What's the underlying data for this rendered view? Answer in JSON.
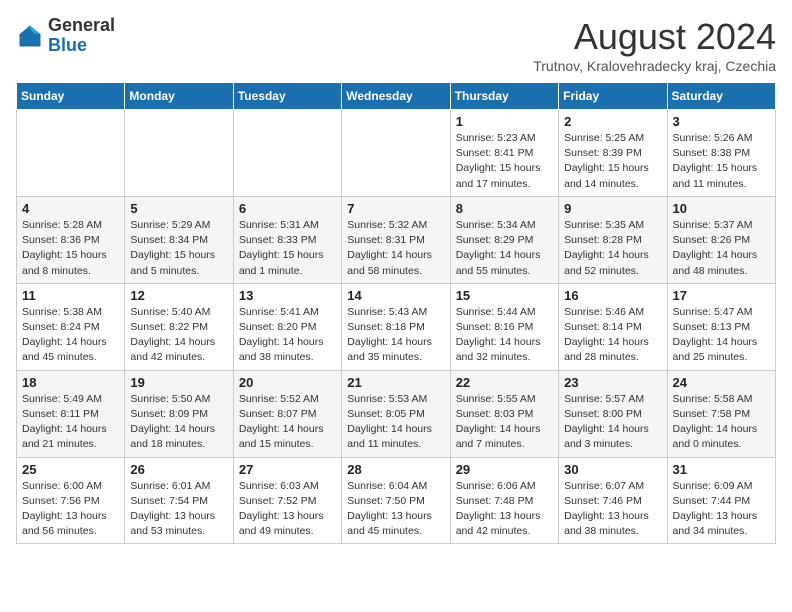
{
  "header": {
    "logo_line1": "General",
    "logo_line2": "Blue",
    "month_year": "August 2024",
    "location": "Trutnov, Kralovehradecky kraj, Czechia"
  },
  "days_of_week": [
    "Sunday",
    "Monday",
    "Tuesday",
    "Wednesday",
    "Thursday",
    "Friday",
    "Saturday"
  ],
  "weeks": [
    [
      {
        "day": "",
        "info": ""
      },
      {
        "day": "",
        "info": ""
      },
      {
        "day": "",
        "info": ""
      },
      {
        "day": "",
        "info": ""
      },
      {
        "day": "1",
        "info": "Sunrise: 5:23 AM\nSunset: 8:41 PM\nDaylight: 15 hours\nand 17 minutes."
      },
      {
        "day": "2",
        "info": "Sunrise: 5:25 AM\nSunset: 8:39 PM\nDaylight: 15 hours\nand 14 minutes."
      },
      {
        "day": "3",
        "info": "Sunrise: 5:26 AM\nSunset: 8:38 PM\nDaylight: 15 hours\nand 11 minutes."
      }
    ],
    [
      {
        "day": "4",
        "info": "Sunrise: 5:28 AM\nSunset: 8:36 PM\nDaylight: 15 hours\nand 8 minutes."
      },
      {
        "day": "5",
        "info": "Sunrise: 5:29 AM\nSunset: 8:34 PM\nDaylight: 15 hours\nand 5 minutes."
      },
      {
        "day": "6",
        "info": "Sunrise: 5:31 AM\nSunset: 8:33 PM\nDaylight: 15 hours\nand 1 minute."
      },
      {
        "day": "7",
        "info": "Sunrise: 5:32 AM\nSunset: 8:31 PM\nDaylight: 14 hours\nand 58 minutes."
      },
      {
        "day": "8",
        "info": "Sunrise: 5:34 AM\nSunset: 8:29 PM\nDaylight: 14 hours\nand 55 minutes."
      },
      {
        "day": "9",
        "info": "Sunrise: 5:35 AM\nSunset: 8:28 PM\nDaylight: 14 hours\nand 52 minutes."
      },
      {
        "day": "10",
        "info": "Sunrise: 5:37 AM\nSunset: 8:26 PM\nDaylight: 14 hours\nand 48 minutes."
      }
    ],
    [
      {
        "day": "11",
        "info": "Sunrise: 5:38 AM\nSunset: 8:24 PM\nDaylight: 14 hours\nand 45 minutes."
      },
      {
        "day": "12",
        "info": "Sunrise: 5:40 AM\nSunset: 8:22 PM\nDaylight: 14 hours\nand 42 minutes."
      },
      {
        "day": "13",
        "info": "Sunrise: 5:41 AM\nSunset: 8:20 PM\nDaylight: 14 hours\nand 38 minutes."
      },
      {
        "day": "14",
        "info": "Sunrise: 5:43 AM\nSunset: 8:18 PM\nDaylight: 14 hours\nand 35 minutes."
      },
      {
        "day": "15",
        "info": "Sunrise: 5:44 AM\nSunset: 8:16 PM\nDaylight: 14 hours\nand 32 minutes."
      },
      {
        "day": "16",
        "info": "Sunrise: 5:46 AM\nSunset: 8:14 PM\nDaylight: 14 hours\nand 28 minutes."
      },
      {
        "day": "17",
        "info": "Sunrise: 5:47 AM\nSunset: 8:13 PM\nDaylight: 14 hours\nand 25 minutes."
      }
    ],
    [
      {
        "day": "18",
        "info": "Sunrise: 5:49 AM\nSunset: 8:11 PM\nDaylight: 14 hours\nand 21 minutes."
      },
      {
        "day": "19",
        "info": "Sunrise: 5:50 AM\nSunset: 8:09 PM\nDaylight: 14 hours\nand 18 minutes."
      },
      {
        "day": "20",
        "info": "Sunrise: 5:52 AM\nSunset: 8:07 PM\nDaylight: 14 hours\nand 15 minutes."
      },
      {
        "day": "21",
        "info": "Sunrise: 5:53 AM\nSunset: 8:05 PM\nDaylight: 14 hours\nand 11 minutes."
      },
      {
        "day": "22",
        "info": "Sunrise: 5:55 AM\nSunset: 8:03 PM\nDaylight: 14 hours\nand 7 minutes."
      },
      {
        "day": "23",
        "info": "Sunrise: 5:57 AM\nSunset: 8:00 PM\nDaylight: 14 hours\nand 3 minutes."
      },
      {
        "day": "24",
        "info": "Sunrise: 5:58 AM\nSunset: 7:58 PM\nDaylight: 14 hours\nand 0 minutes."
      }
    ],
    [
      {
        "day": "25",
        "info": "Sunrise: 6:00 AM\nSunset: 7:56 PM\nDaylight: 13 hours\nand 56 minutes."
      },
      {
        "day": "26",
        "info": "Sunrise: 6:01 AM\nSunset: 7:54 PM\nDaylight: 13 hours\nand 53 minutes."
      },
      {
        "day": "27",
        "info": "Sunrise: 6:03 AM\nSunset: 7:52 PM\nDaylight: 13 hours\nand 49 minutes."
      },
      {
        "day": "28",
        "info": "Sunrise: 6:04 AM\nSunset: 7:50 PM\nDaylight: 13 hours\nand 45 minutes."
      },
      {
        "day": "29",
        "info": "Sunrise: 6:06 AM\nSunset: 7:48 PM\nDaylight: 13 hours\nand 42 minutes."
      },
      {
        "day": "30",
        "info": "Sunrise: 6:07 AM\nSunset: 7:46 PM\nDaylight: 13 hours\nand 38 minutes."
      },
      {
        "day": "31",
        "info": "Sunrise: 6:09 AM\nSunset: 7:44 PM\nDaylight: 13 hours\nand 34 minutes."
      }
    ]
  ]
}
